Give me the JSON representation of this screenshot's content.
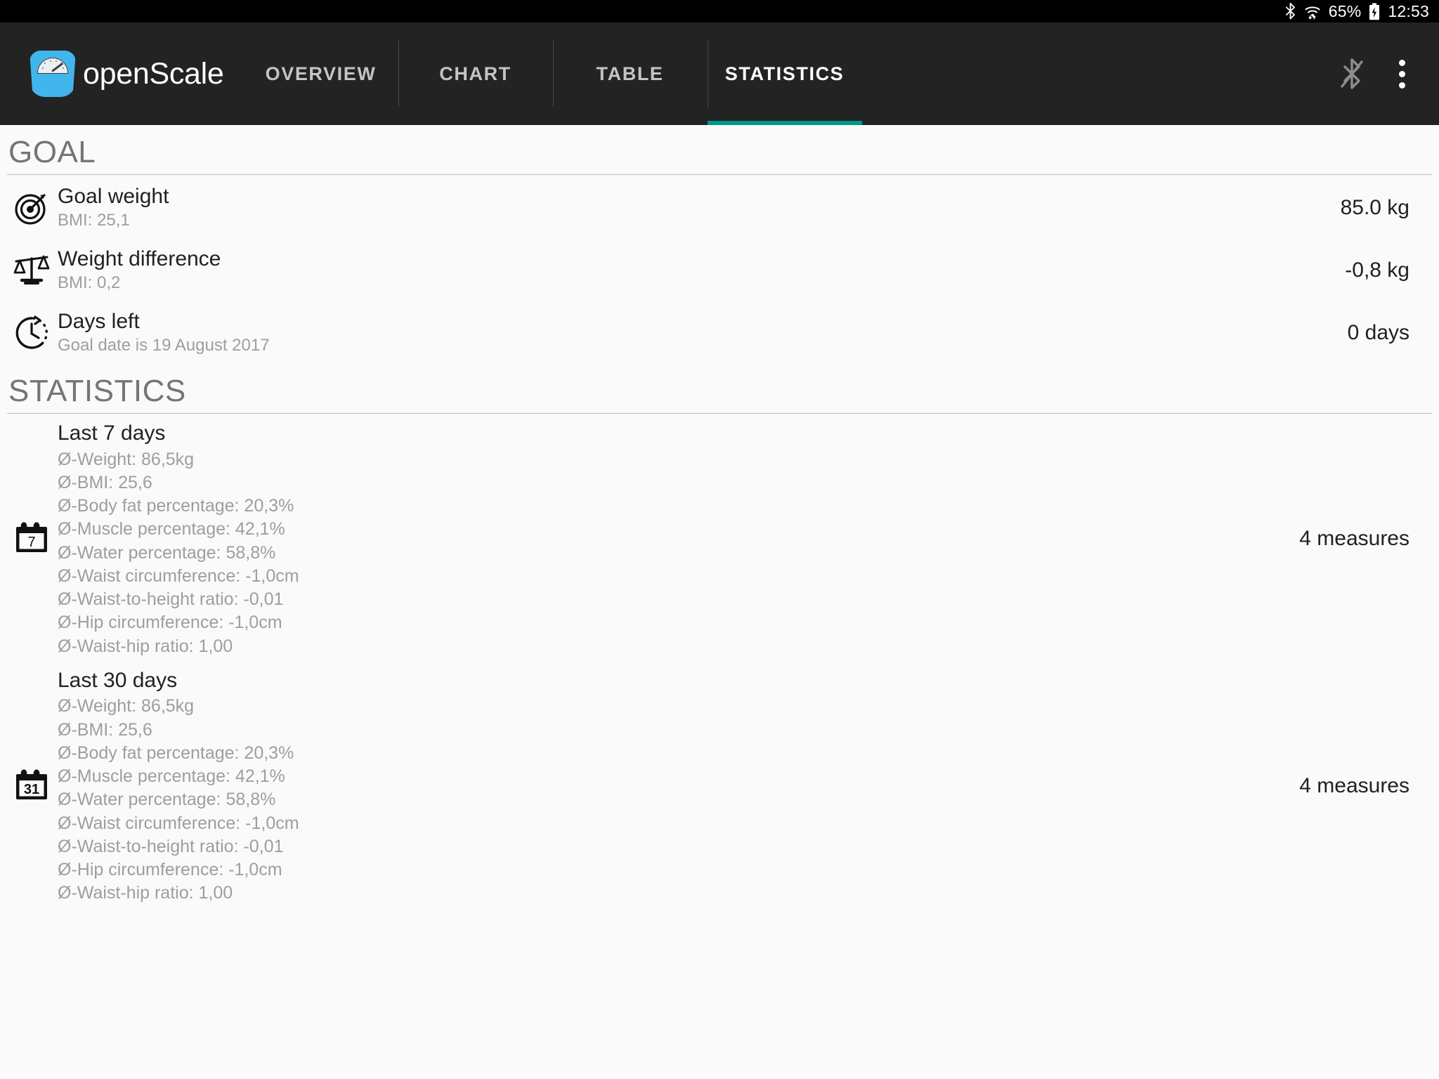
{
  "statusbar": {
    "bluetooth_icon": "bluetooth-icon",
    "wifi_icon": "wifi-icon",
    "battery_percent": "65%",
    "battery_icon": "battery-charging-icon",
    "clock": "12:53"
  },
  "appbar": {
    "logo_icon": "openscale-logo-icon",
    "title": "openScale",
    "brand_color": "#42b6ec",
    "background": "#232323",
    "accent_color": "#009688",
    "actions": {
      "bluetooth_off_icon": "bluetooth-disabled-icon",
      "overflow_icon": "overflow-menu-icon"
    },
    "tabs": [
      {
        "label": "OVERVIEW",
        "active": false
      },
      {
        "label": "CHART",
        "active": false
      },
      {
        "label": "TABLE",
        "active": false
      },
      {
        "label": "STATISTICS",
        "active": true
      }
    ]
  },
  "goal": {
    "header": "GOAL",
    "rows": [
      {
        "icon": "target-icon",
        "title": "Goal weight",
        "subtitle": "BMI: 25,1",
        "value": "85.0 kg"
      },
      {
        "icon": "balance-scale-icon",
        "title": "Weight difference",
        "subtitle": "BMI: 0,2",
        "value": "-0,8 kg"
      },
      {
        "icon": "clock-dashed-icon",
        "title": "Days left",
        "subtitle": "Goal date is 19 August 2017",
        "value": "0 days"
      }
    ]
  },
  "statistics": {
    "header": "STATISTICS",
    "blocks": [
      {
        "icon": "calendar-7-icon",
        "icon_day": "7",
        "title": "Last 7 days",
        "value": "4 measures",
        "lines": [
          "Ø-Weight: 86,5kg",
          "Ø-BMI: 25,6",
          "Ø-Body fat percentage: 20,3%",
          "Ø-Muscle percentage: 42,1%",
          "Ø-Water percentage: 58,8%",
          "Ø-Waist circumference: -1,0cm",
          "Ø-Waist-to-height ratio: -0,01",
          "Ø-Hip circumference: -1,0cm",
          "Ø-Waist-hip ratio: 1,00"
        ]
      },
      {
        "icon": "calendar-31-icon",
        "icon_day": "31",
        "title": "Last 30 days",
        "value": "4 measures",
        "lines": [
          "Ø-Weight: 86,5kg",
          "Ø-BMI: 25,6",
          "Ø-Body fat percentage: 20,3%",
          "Ø-Muscle percentage: 42,1%",
          "Ø-Water percentage: 58,8%",
          "Ø-Waist circumference: -1,0cm",
          "Ø-Waist-to-height ratio: -0,01",
          "Ø-Hip circumference: -1,0cm",
          "Ø-Waist-hip ratio: 1,00"
        ]
      }
    ]
  }
}
